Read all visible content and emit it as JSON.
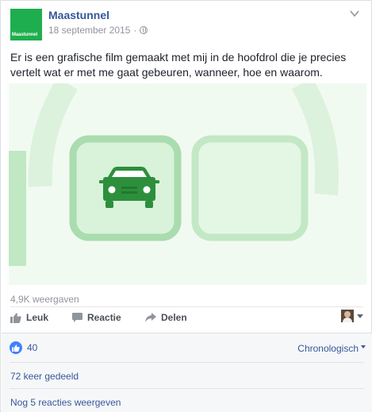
{
  "post": {
    "page_name": "Maastunnel",
    "logo_text": "Maastunnel",
    "date": "18 september 2015",
    "separator": "·",
    "text": "Er is een grafische film gemaakt met mij in de hoofdrol die je precies vertelt wat er met me gaat gebeuren, wanneer, hoe en waarom."
  },
  "video": {
    "views": "4,9K weergaven"
  },
  "actions": {
    "like": "Leuk",
    "comment": "Reactie",
    "share": "Delen"
  },
  "footer": {
    "like_count": "40",
    "sort_label": "Chronologisch",
    "shares": "72 keer gedeeld",
    "more_comments": "Nog 5 reacties weergeven"
  },
  "colors": {
    "brand_green": "#1fae4f",
    "link_blue": "#365899",
    "like_blue": "#4080ff"
  },
  "icons": {
    "globe": "globe-icon",
    "like": "thumbs-up-icon",
    "comment": "comment-icon",
    "share": "share-arrow-icon",
    "menu": "chevron-down-icon"
  }
}
